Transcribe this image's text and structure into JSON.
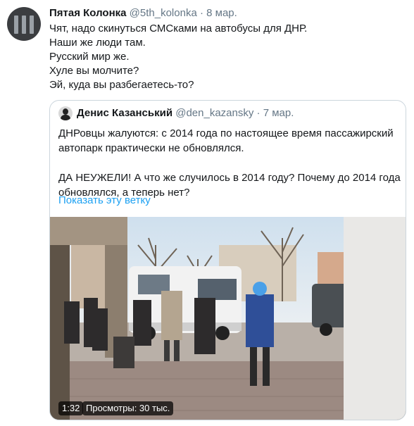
{
  "tweet": {
    "author_name": "Пятая Колонка",
    "author_handle": "@5th_kolonka",
    "separator": "·",
    "date": "8 мар.",
    "lines": [
      "Чят, надо скинуться СМСками на автобусы для ДНР.",
      "Наши же люди там.",
      "Русский мир же.",
      "Хуле вы молчите?",
      "Эй, куда вы разбегаетесь-то?"
    ]
  },
  "quoted_tweet": {
    "author_name": "Денис Казанський",
    "author_handle": "@den_kazansky",
    "separator": "·",
    "date": "7 мар.",
    "paragraph_1": "ДНРовцы жалуются: с 2014 года по настоящее время пассажирский автопарк практически не обновлялся.",
    "paragraph_2": "ДА НЕУЖЕЛИ! А что же случилось в 2014 году? Почему до 2014 года обновлялся, а теперь нет?",
    "show_thread": "Показать эту ветку",
    "video": {
      "duration": "1:32",
      "views": "Просмотры: 30 тыс."
    }
  },
  "colors": {
    "text": "#14171a",
    "secondary": "#657786",
    "link": "#1da1f2",
    "border": "#ccd6dd"
  }
}
